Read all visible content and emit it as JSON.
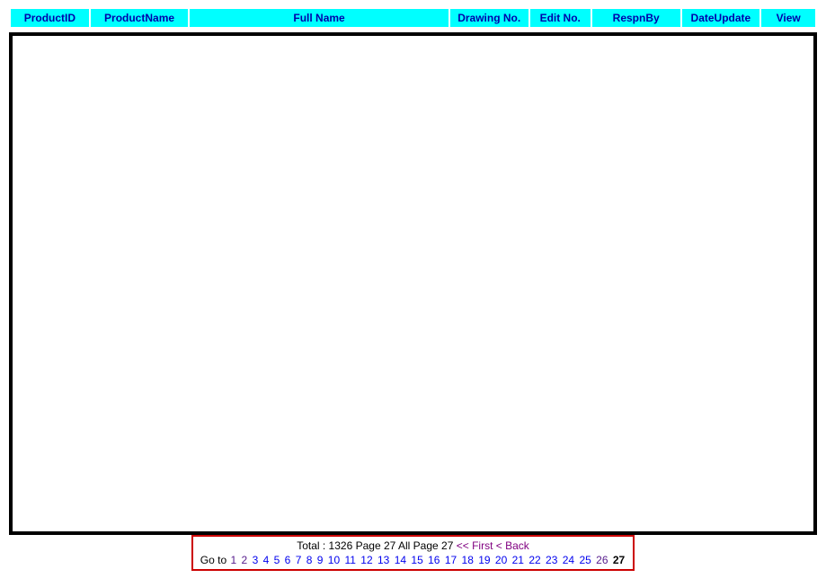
{
  "header": {
    "columns": [
      "ProductID",
      "ProductName",
      "Full Name",
      "Drawing No.",
      "Edit No.",
      "RespnBy",
      "DateUpdate",
      "View"
    ]
  },
  "pagination": {
    "total_label": "Total :",
    "total_value": "1326",
    "page_label": "Page",
    "current_page": "27",
    "all_page_label": "All Page",
    "total_pages": "27",
    "nav_first": "<< First",
    "nav_back": "< Back",
    "goto_label": "Go to",
    "pages": [
      "1",
      "2",
      "3",
      "4",
      "5",
      "6",
      "7",
      "8",
      "9",
      "10",
      "11",
      "12",
      "13",
      "14",
      "15",
      "16",
      "17",
      "18",
      "19",
      "20",
      "21",
      "22",
      "23",
      "24",
      "25",
      "26"
    ],
    "current_page_display": "27"
  }
}
